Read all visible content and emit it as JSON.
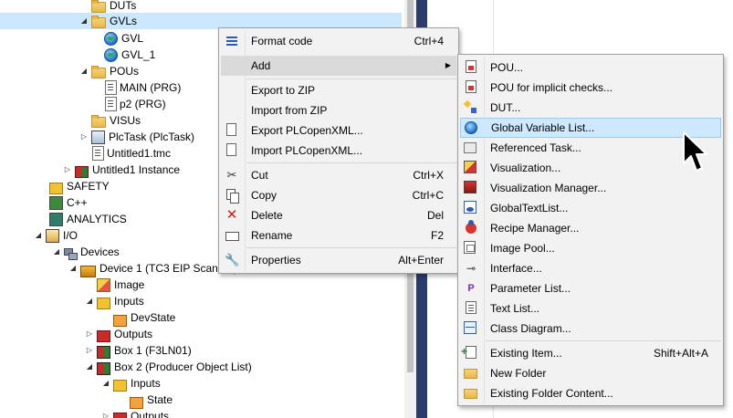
{
  "tree": {
    "items": [
      {
        "label": "DUTs",
        "icon": "folder-icon"
      },
      {
        "label": "GVLs",
        "icon": "folder-open-icon"
      },
      {
        "label": "GVL",
        "icon": "gvl-globe-icon"
      },
      {
        "label": "GVL_1",
        "icon": "gvl-globe-icon"
      },
      {
        "label": "POUs",
        "icon": "folder-open-icon"
      },
      {
        "label": "MAIN (PRG)",
        "icon": "pou-doc-icon"
      },
      {
        "label": "p2 (PRG)",
        "icon": "pou-doc-icon"
      },
      {
        "label": "VISUs",
        "icon": "folder-icon"
      },
      {
        "label": "PlcTask (PlcTask)",
        "icon": "task-icon"
      },
      {
        "label": "Untitled1.tmc",
        "icon": "tmc-file-icon"
      },
      {
        "label": "Untitled1 Instance",
        "icon": "instance-icon"
      },
      {
        "label": "SAFETY",
        "icon": "safety-icon"
      },
      {
        "label": "C++",
        "icon": "cpp-icon"
      },
      {
        "label": "ANALYTICS",
        "icon": "analytics-icon"
      },
      {
        "label": "I/O",
        "icon": "io-icon"
      },
      {
        "label": "Devices",
        "icon": "devices-icon"
      },
      {
        "label": "Device 1 (TC3 EIP Scanner)",
        "icon": "device-icon"
      },
      {
        "label": "Image",
        "icon": "image-icon"
      },
      {
        "label": "Inputs",
        "icon": "inputs-icon"
      },
      {
        "label": "DevState",
        "icon": "state-icon"
      },
      {
        "label": "Outputs",
        "icon": "outputs-icon"
      },
      {
        "label": "Box 1 (F3LN01)",
        "icon": "box-icon"
      },
      {
        "label": "Box 2 (Producer Object List)",
        "icon": "box-icon"
      },
      {
        "label": "Inputs",
        "icon": "inputs-icon"
      },
      {
        "label": "State",
        "icon": "state-icon"
      },
      {
        "label": "Outputs",
        "icon": "outputs-icon"
      }
    ]
  },
  "context_menu": {
    "items": [
      {
        "label": "Format code",
        "shortcut": "Ctrl+4",
        "icon": "format-code-icon"
      },
      {
        "label": "Add",
        "shortcut": "",
        "icon": "",
        "submenu": true
      },
      {
        "label": "Export to ZIP",
        "shortcut": "",
        "icon": ""
      },
      {
        "label": "Import from ZIP",
        "shortcut": "",
        "icon": ""
      },
      {
        "label": "Export PLCopenXML...",
        "shortcut": "",
        "icon": "export-xml-icon"
      },
      {
        "label": "Import PLCopenXML...",
        "shortcut": "",
        "icon": "import-xml-icon"
      },
      {
        "label": "Cut",
        "shortcut": "Ctrl+X",
        "icon": "scissors-icon"
      },
      {
        "label": "Copy",
        "shortcut": "Ctrl+C",
        "icon": "copy-icon"
      },
      {
        "label": "Delete",
        "shortcut": "Del",
        "icon": "delete-x-icon"
      },
      {
        "label": "Rename",
        "shortcut": "F2",
        "icon": "rename-icon"
      },
      {
        "label": "Properties",
        "shortcut": "Alt+Enter",
        "icon": "wrench-icon"
      }
    ],
    "submenu_arrow": "▶"
  },
  "submenu": {
    "items": [
      {
        "label": "POU...",
        "shortcut": ""
      },
      {
        "label": "POU for implicit checks...",
        "shortcut": ""
      },
      {
        "label": "DUT...",
        "shortcut": ""
      },
      {
        "label": "Global Variable List...",
        "shortcut": ""
      },
      {
        "label": "Referenced Task...",
        "shortcut": ""
      },
      {
        "label": "Visualization...",
        "shortcut": ""
      },
      {
        "label": "Visualization Manager...",
        "shortcut": ""
      },
      {
        "label": "GlobalTextList...",
        "shortcut": ""
      },
      {
        "label": "Recipe Manager...",
        "shortcut": ""
      },
      {
        "label": "Image Pool...",
        "shortcut": ""
      },
      {
        "label": "Interface...",
        "shortcut": ""
      },
      {
        "label": "Parameter List...",
        "shortcut": ""
      },
      {
        "label": "Text List...",
        "shortcut": ""
      },
      {
        "label": "Class Diagram...",
        "shortcut": ""
      },
      {
        "label": "Existing Item...",
        "shortcut": "Shift+Alt+A"
      },
      {
        "label": "New Folder",
        "shortcut": ""
      },
      {
        "label": "Existing Folder Content...",
        "shortcut": ""
      }
    ]
  },
  "icons": {
    "twisty_expanded": "◢",
    "twisty_collapsed": "▷",
    "cut": "✂",
    "delete": "✕",
    "properties": "🔧",
    "interface": "⊸",
    "parameter": "P"
  },
  "colors": {
    "selection": "#cce8ff",
    "menu_bg": "#f2f2f2",
    "menu_highlight": "#cde8ff",
    "splitter": "#2b3b6b"
  }
}
